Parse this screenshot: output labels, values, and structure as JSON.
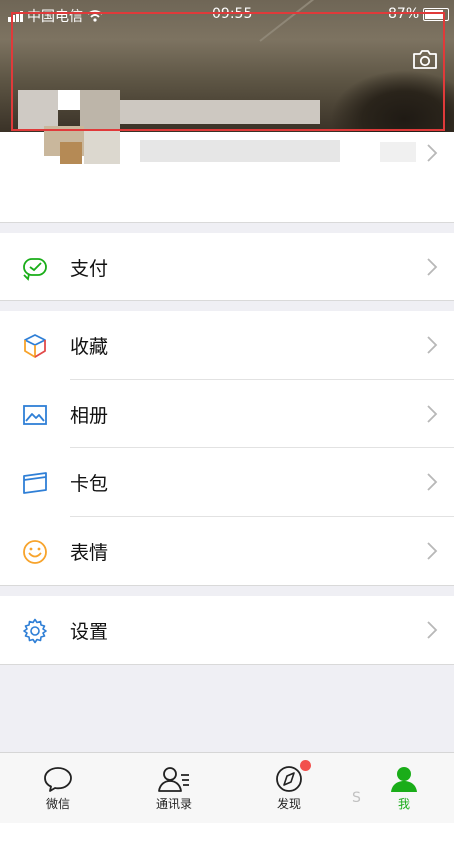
{
  "status_bar": {
    "carrier": "中国电信",
    "time": "09:55",
    "battery": "87%"
  },
  "menu": {
    "pay": "支付",
    "favorites": "收藏",
    "album": "相册",
    "wallet": "卡包",
    "stickers": "表情",
    "settings": "设置"
  },
  "tabbar": {
    "chats": "微信",
    "contacts": "通讯录",
    "discover": "发现",
    "me": "我"
  },
  "colors": {
    "accent": "#1aad19",
    "badge": "#f2504d",
    "highlight_box": "#e03a3a"
  },
  "watermark": "S"
}
